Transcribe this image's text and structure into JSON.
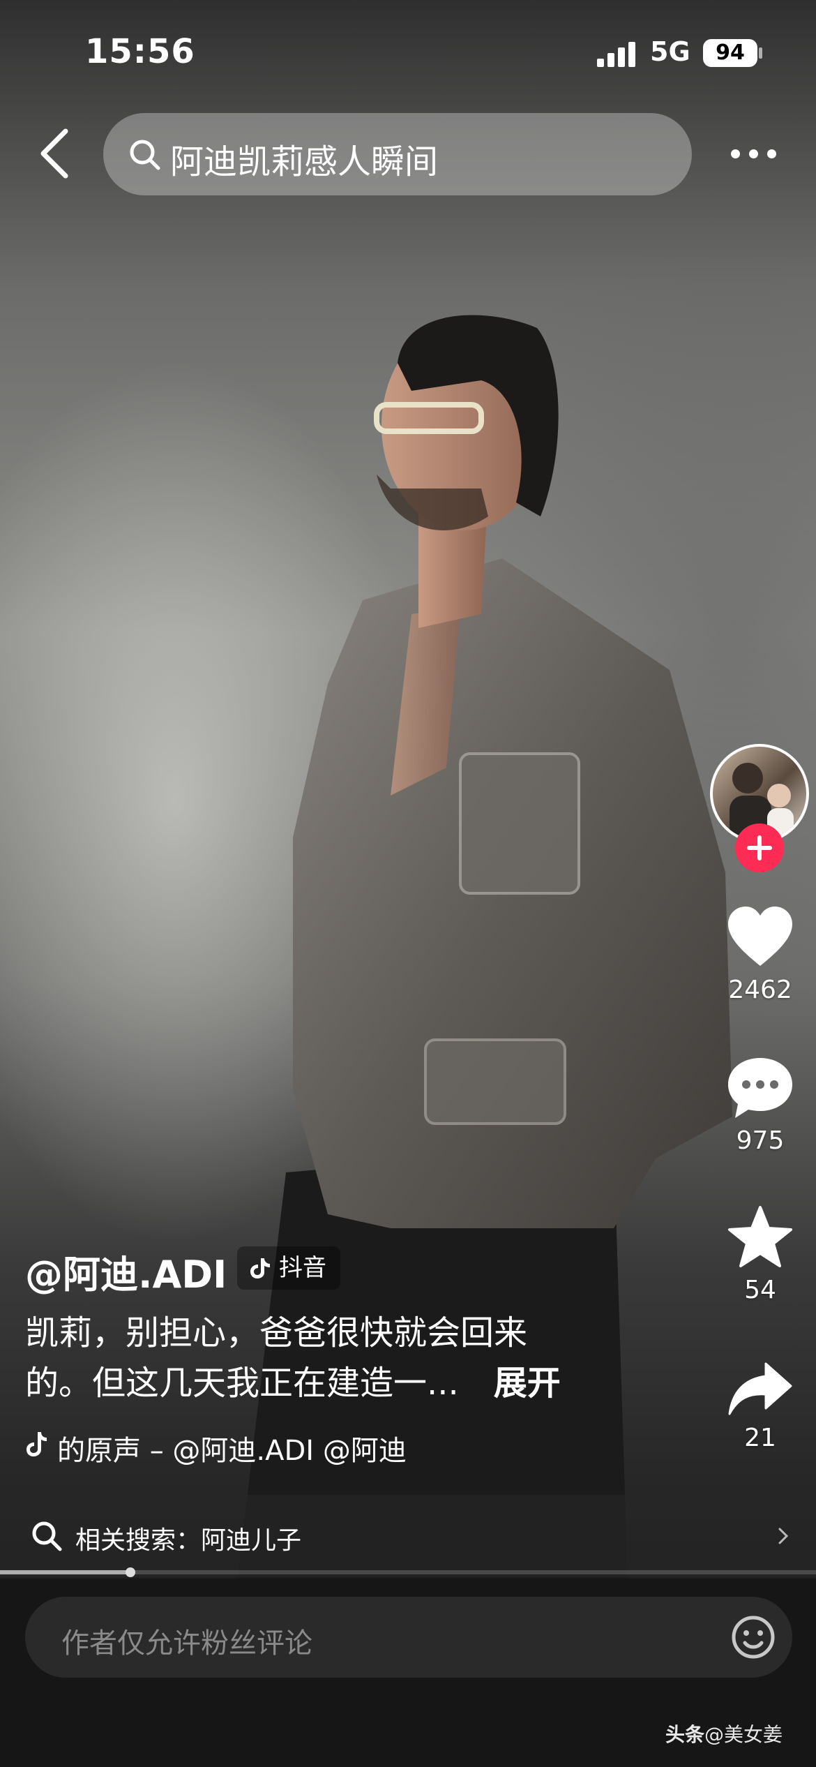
{
  "status_bar": {
    "time": "15:56",
    "network": "5G",
    "battery": "94"
  },
  "header": {
    "search_query": "阿迪凯莉感人瞬间"
  },
  "side_actions": {
    "likes": "2462",
    "comments": "975",
    "favorites": "54",
    "shares": "21"
  },
  "post": {
    "author": "@阿迪.ADI",
    "platform_tag": "抖音",
    "caption_line1": "凯莉，别担心，爸爸很快就会回来",
    "caption_line2": "的。但这几天我正在建造一...",
    "expand_label": "展开",
    "music": "的原声 – @阿迪.ADI    @阿迪"
  },
  "related_search": {
    "label": "相关搜索：阿迪儿子"
  },
  "playback": {
    "progress_fraction": 0.16
  },
  "comment_bar": {
    "placeholder": "作者仅允许粉丝评论"
  },
  "watermark": {
    "brand": "头条",
    "handle": "@美女姜"
  },
  "colors": {
    "accent_follow": "#fe2c55",
    "bottom_bg": "#161616"
  }
}
